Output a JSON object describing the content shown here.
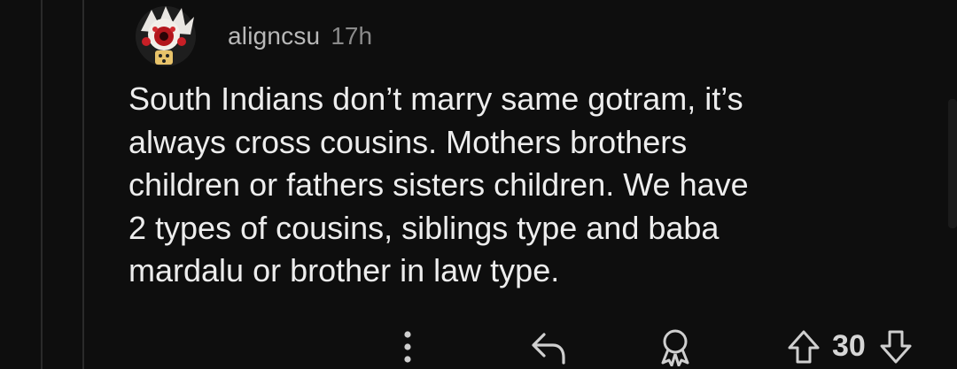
{
  "comment": {
    "author": "aligncsu",
    "age": "17h",
    "avatar_icon": "red-white-cartoon-avatar",
    "body_lines": [
      "South Indians don’t marry same gotram, it’s",
      "always cross cousins. Mothers brothers",
      "children or fathers sisters children. We have",
      "2 types of cousins, siblings type and baba",
      "mardalu or brother in law type."
    ],
    "score": "30"
  },
  "actions": {
    "more_icon": "more-vertical-icon",
    "reply_icon": "reply-icon",
    "award_icon": "award-icon",
    "upvote_icon": "upvote-icon",
    "downvote_icon": "downvote-icon"
  },
  "colors": {
    "background": "#0e0e0e",
    "text": "#ededed",
    "meta": "#8a8a8a",
    "thread_line": "#2a2a2a"
  }
}
